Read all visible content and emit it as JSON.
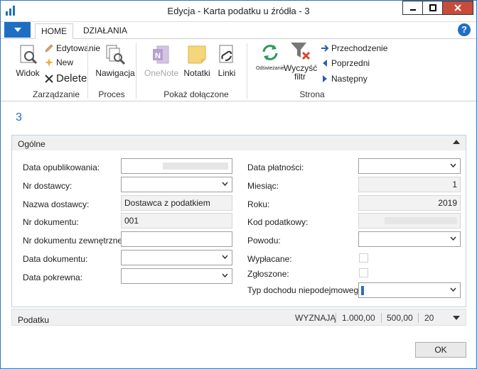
{
  "window": {
    "title": "Edycja - Karta podatku u źródła - 3"
  },
  "tabs": [
    {
      "label": "HOME"
    },
    {
      "label": "DZIAŁANIA"
    }
  ],
  "ribbon": {
    "zarzadzanie": {
      "label": "Zarządzanie",
      "widok": "Widok",
      "edytowanie": "Edytowanie",
      "new": "New",
      "delete": "Delete"
    },
    "proces": {
      "label": "Proces",
      "nawigacja": "Nawigacja"
    },
    "pokaz": {
      "label": "Pokaż dołączone",
      "onenote": "OneNote",
      "notatki": "Notatki",
      "linki": "Linki"
    },
    "strona": {
      "label": "Strona",
      "odswiezanie": "Odświeżanie",
      "wyczysc": "Wyczyść",
      "filtr": "filtr",
      "przechodzenie": "Przechodzenie",
      "poprzedni": "Poprzedni",
      "nastepny": "Następny"
    }
  },
  "record_title": "3",
  "ogolne": {
    "caption": "Ogólne",
    "left": {
      "data_opublikowania": {
        "label": "Data opublikowania:"
      },
      "nr_dostawcy": {
        "label": "Nr dostawcy:"
      },
      "nazwa_dostawcy": {
        "label": "Nazwa dostawcy:",
        "value": "Dostawca z podatkiem"
      },
      "nr_dokumentu": {
        "label": "Nr dokumentu:",
        "value": "001"
      },
      "nr_dokumentu_zewn": {
        "label": "Nr dokumentu zewnętrznego:"
      },
      "data_dokumentu": {
        "label": "Data dokumentu:"
      },
      "data_pokrewna": {
        "label": "Data pokrewna:"
      }
    },
    "right": {
      "data_platnosci": {
        "label": "Data płatności:"
      },
      "miesiac": {
        "label": "Miesiąc:",
        "value": "1"
      },
      "roku": {
        "label": "Roku:",
        "value": "2019"
      },
      "kod_podatkowy": {
        "label": "Kod podatkowy:"
      },
      "powodu": {
        "label": "Powodu:"
      },
      "wyplacane": {
        "label": "Wypłacane:"
      },
      "zgloszone": {
        "label": "Zgłoszone:"
      },
      "typ_dochodu": {
        "label": "Typ dochodu niepodejmowego opodatkowania:"
      }
    }
  },
  "podatku": {
    "caption": "Podatku",
    "summary": [
      "WYZNAJĄ",
      "1.000,00",
      "500,00",
      "20"
    ]
  },
  "ok_label": "OK"
}
